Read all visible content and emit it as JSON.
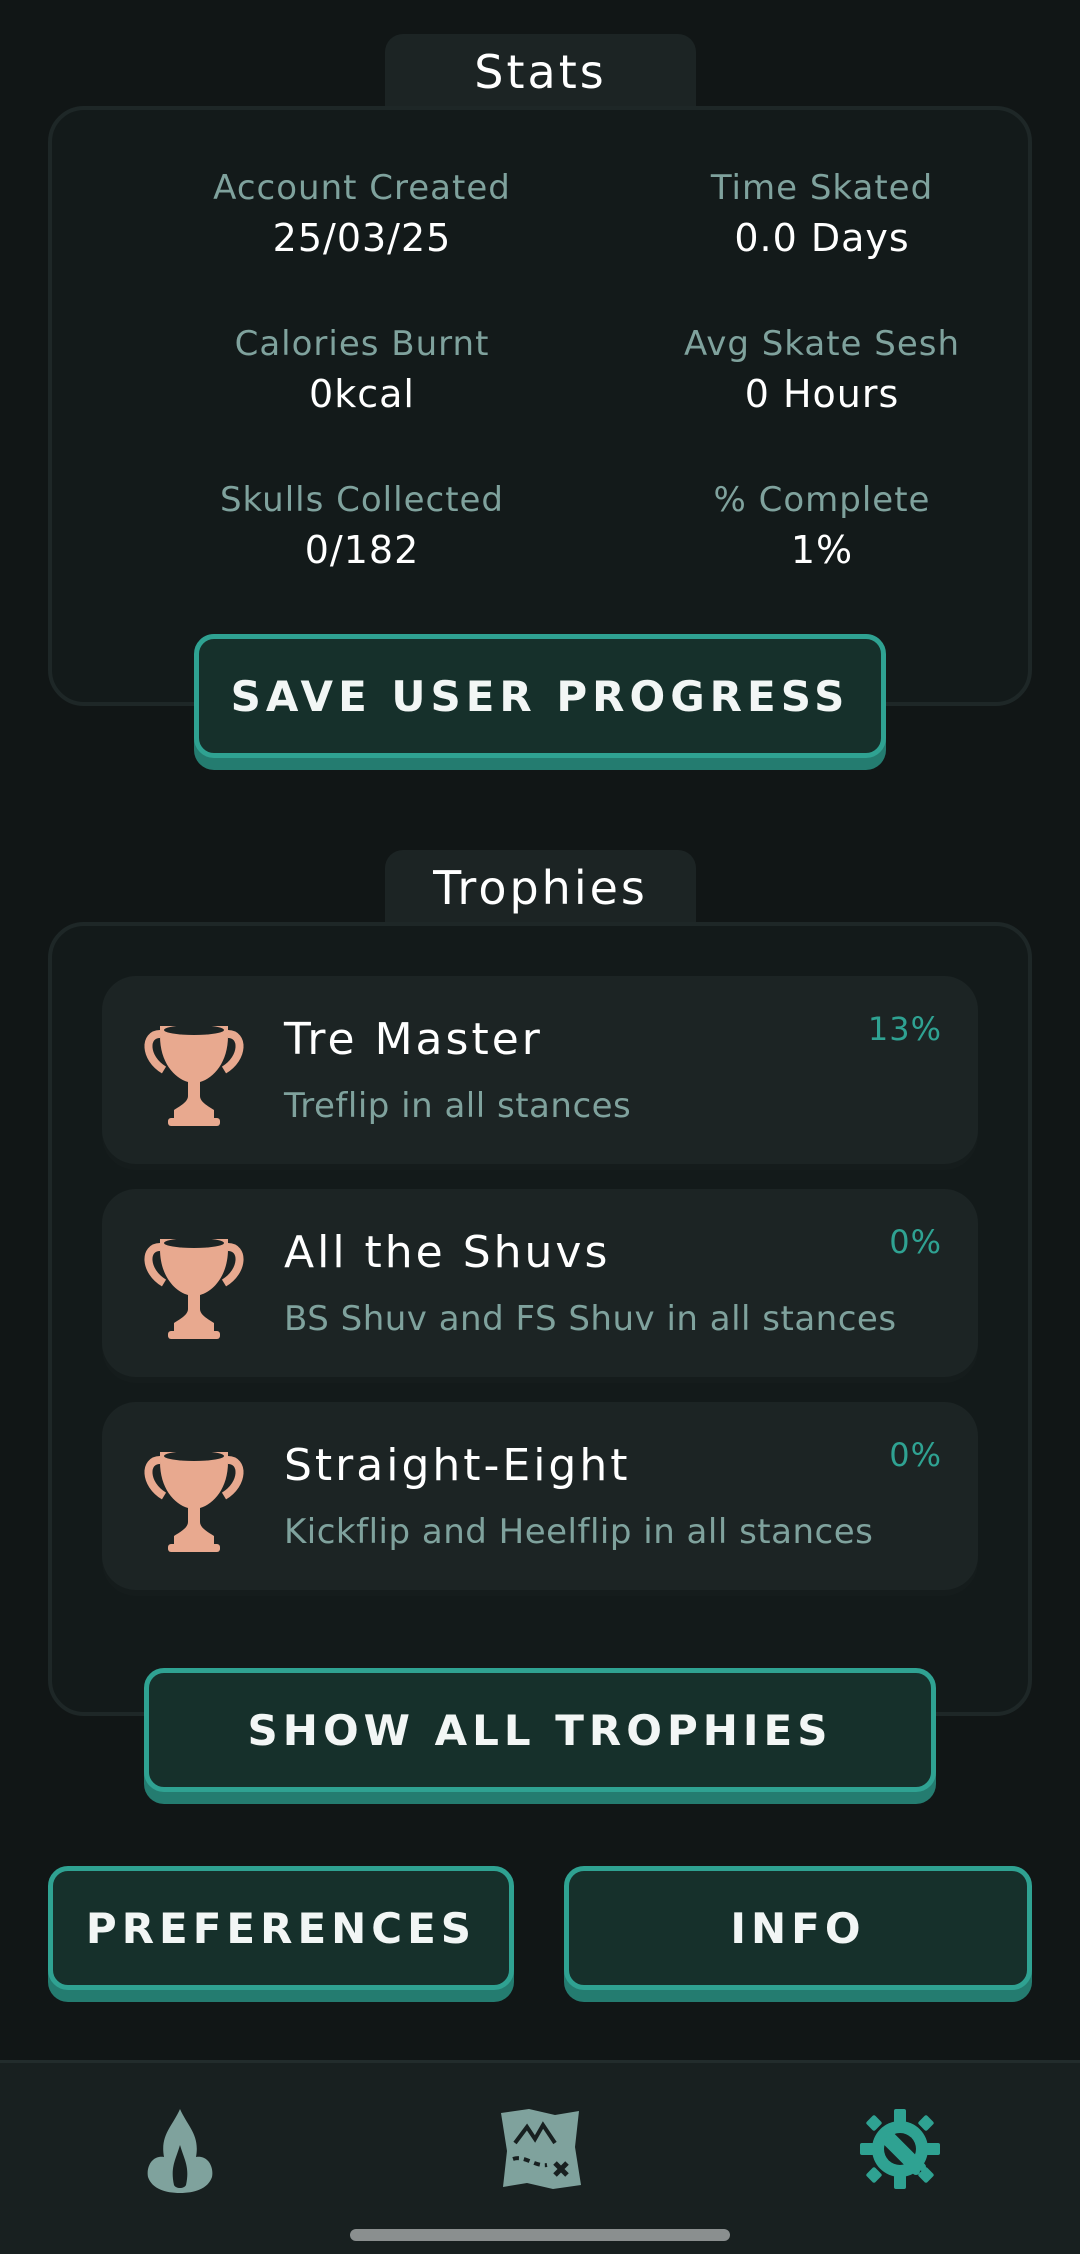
{
  "stats": {
    "title": "Stats",
    "items": [
      {
        "label": "Account Created",
        "value": "25/03/25"
      },
      {
        "label": "Time Skated",
        "value": "0.0 Days"
      },
      {
        "label": "Calories Burnt",
        "value": "0kcal"
      },
      {
        "label": "Avg Skate Sesh",
        "value": "0 Hours"
      },
      {
        "label": "Skulls Collected",
        "value": "0/182"
      },
      {
        "label": "% Complete",
        "value": "1%"
      }
    ],
    "save_button": "SAVE USER PROGRESS"
  },
  "trophies": {
    "title": "Trophies",
    "items": [
      {
        "name": "Tre Master",
        "description": "Treflip in all stances",
        "percent": "13%",
        "icon": "trophy-icon"
      },
      {
        "name": "All the Shuvs",
        "description": "BS Shuv and FS Shuv in all stances",
        "percent": "0%",
        "icon": "trophy-icon"
      },
      {
        "name": "Straight-Eight",
        "description": "Kickflip and Heelflip in all stances",
        "percent": "0%",
        "icon": "trophy-icon"
      }
    ],
    "show_all_button": "SHOW ALL TROPHIES"
  },
  "buttons": {
    "preferences": "PREFERENCES",
    "info": "INFO"
  },
  "bottom_nav": {
    "items": [
      {
        "icon": "flame-icon",
        "active": false
      },
      {
        "icon": "treasure-map-icon",
        "active": false
      },
      {
        "icon": "settings-wrench-gear-icon",
        "active": true
      }
    ]
  },
  "colors": {
    "background": "#111616",
    "card": "#1c2424",
    "accent": "#2fa292",
    "muted_text": "#7fa29d",
    "trophy_bronze": "#e8a98f"
  }
}
